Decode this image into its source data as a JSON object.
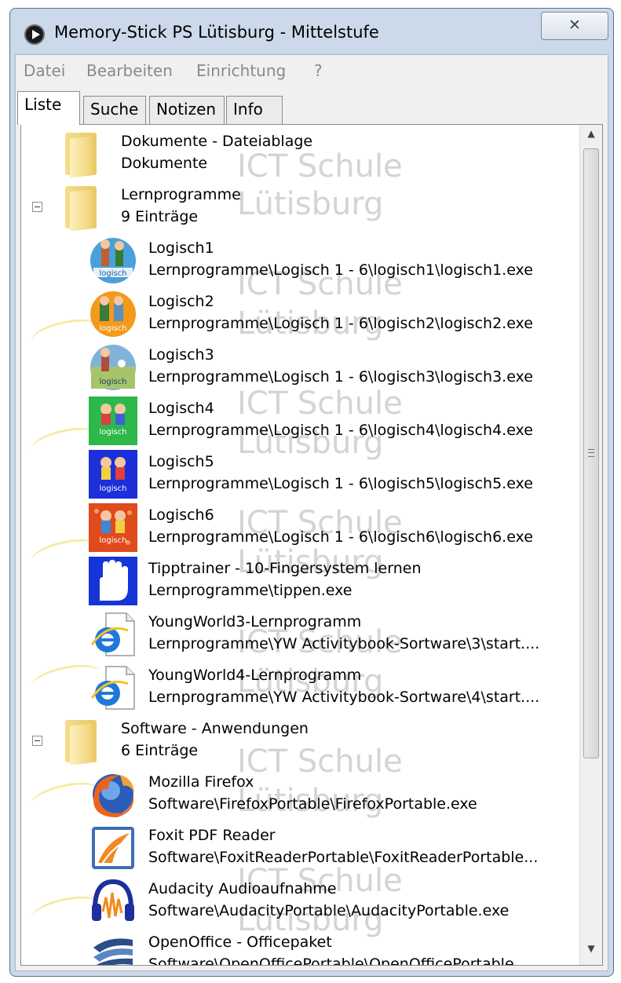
{
  "window": {
    "title": "Memory-Stick PS Lütisburg - Mittelstufe",
    "close_label": "✕"
  },
  "menu": [
    "Datei",
    "Bearbeiten",
    "Einrichtung",
    "?"
  ],
  "tabs": [
    {
      "label": "Liste",
      "active": true
    },
    {
      "label": "Suche",
      "active": false
    },
    {
      "label": "Notizen",
      "active": false
    },
    {
      "label": "Info",
      "active": false
    }
  ],
  "watermark": [
    "ICT Schule",
    "Lütisburg"
  ],
  "items": [
    {
      "kind": "folder",
      "title": "Dokumente - Dateiablage",
      "subtitle": "Dokumente",
      "expanded": false
    },
    {
      "kind": "folder",
      "title": "Lernprogramme",
      "subtitle": "9 Einträge",
      "expanded": true
    },
    {
      "kind": "app",
      "icon": "logisch1-icon",
      "title": "Logisch1",
      "subtitle": "Lernprogramme\\Logisch 1 - 6\\logisch1\\logisch1.exe"
    },
    {
      "kind": "app",
      "icon": "logisch2-icon",
      "title": "Logisch2",
      "subtitle": "Lernprogramme\\Logisch 1 - 6\\logisch2\\logisch2.exe"
    },
    {
      "kind": "app",
      "icon": "logisch3-icon",
      "title": "Logisch3",
      "subtitle": "Lernprogramme\\Logisch 1 - 6\\logisch3\\logisch3.exe"
    },
    {
      "kind": "app",
      "icon": "logisch4-icon",
      "title": "Logisch4",
      "subtitle": "Lernprogramme\\Logisch 1 - 6\\logisch4\\logisch4.exe"
    },
    {
      "kind": "app",
      "icon": "logisch5-icon",
      "title": "Logisch5",
      "subtitle": "Lernprogramme\\Logisch 1 - 6\\logisch5\\logisch5.exe"
    },
    {
      "kind": "app",
      "icon": "logisch6-icon",
      "title": "Logisch6",
      "subtitle": "Lernprogramme\\Logisch 1 - 6\\logisch6\\logisch6.exe"
    },
    {
      "kind": "app",
      "icon": "hand-icon",
      "title": "Tipptrainer - 10-Fingersystem lernen",
      "subtitle": "Lernprogramme\\tippen.exe"
    },
    {
      "kind": "app",
      "icon": "internet-explorer-icon",
      "title": "YoungWorld3-Lernprogramm",
      "subtitle": "Lernprogramme\\YW Activitybook-Sortware\\3\\start...."
    },
    {
      "kind": "app",
      "icon": "internet-explorer-icon",
      "title": "YoungWorld4-Lernprogramm",
      "subtitle": "Lernprogramme\\YW Activitybook-Sortware\\4\\start...."
    },
    {
      "kind": "folder",
      "title": "Software - Anwendungen",
      "subtitle": "6 Einträge",
      "expanded": true
    },
    {
      "kind": "app",
      "icon": "firefox-icon",
      "title": "Mozilla Firefox",
      "subtitle": "Software\\FirefoxPortable\\FirefoxPortable.exe"
    },
    {
      "kind": "app",
      "icon": "foxit-reader-icon",
      "title": "Foxit PDF Reader",
      "subtitle": "Software\\FoxitReaderPortable\\FoxitReaderPortable..."
    },
    {
      "kind": "app",
      "icon": "audacity-icon",
      "title": "Audacity Audioaufnahme",
      "subtitle": "Software\\AudacityPortable\\AudacityPortable.exe"
    },
    {
      "kind": "app",
      "icon": "openoffice-icon",
      "title": "OpenOffice - Officepaket",
      "subtitle": "Software\\OpenOfficePortable\\OpenOfficePortable..."
    }
  ],
  "scrollbar": {
    "up": "▲",
    "down": "▼"
  }
}
